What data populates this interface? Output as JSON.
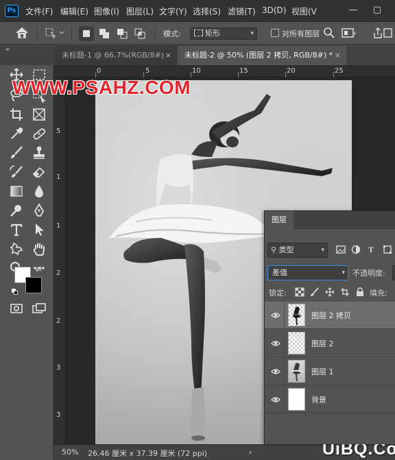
{
  "app": {
    "logo_text": "Ps"
  },
  "menu": {
    "items": [
      {
        "label": "文件(F)"
      },
      {
        "label": "编辑(E)"
      },
      {
        "label": "图像(I)"
      },
      {
        "label": "图层(L)"
      },
      {
        "label": "文字(Y)"
      },
      {
        "label": "选择(S)"
      },
      {
        "label": "滤镜(T)"
      },
      {
        "label": "3D(D)"
      },
      {
        "label": "视图(V"
      }
    ],
    "window_buttons": {
      "minimize": "—",
      "maximize": "▢"
    }
  },
  "options_bar": {
    "mode_label": "模式:",
    "mode_value": "矩形",
    "checkbox_label": "对所有图层"
  },
  "tabs": [
    {
      "label": "未标题-1 @ 66.7%(RGB/8#)",
      "active": false,
      "close": "×"
    },
    {
      "label": "未标题-2 @ 50% (图层 2 拷贝, RGB/8#) *",
      "active": true,
      "close": "×"
    }
  ],
  "rulers": {
    "horizontal": [
      "0",
      "5",
      "10",
      "15",
      "20",
      "25"
    ],
    "vertical": [
      "5",
      "1",
      "1",
      "2",
      "2",
      "3",
      "3"
    ]
  },
  "document": {
    "watermark": "WWW.PSAHZ.COM"
  },
  "status_bar": {
    "zoom": "50%",
    "doc_info": "26.46 厘米 x 37.39 厘米 (72 ppi)",
    "arrow": "›"
  },
  "site_logo": "UiBQ.CoM",
  "layers_panel": {
    "tab_label": "图层",
    "filter_value": "类型",
    "blend_mode": "差值",
    "opacity_label": "不透明度:",
    "lock_label": "锁定:",
    "fill_label": "填充:",
    "layers": [
      {
        "name": "图层 2 拷贝",
        "selected": true,
        "thumb": "dancer-checker"
      },
      {
        "name": "图层 2",
        "selected": false,
        "thumb": "checker"
      },
      {
        "name": "图层 1",
        "selected": false,
        "thumb": "dancer"
      },
      {
        "name": "背景",
        "selected": false,
        "thumb": "white"
      }
    ]
  },
  "colors": {
    "foreground": "#ffffff",
    "background": "#000000",
    "watermark": "#e1252b",
    "accent": "#31a8ff"
  }
}
